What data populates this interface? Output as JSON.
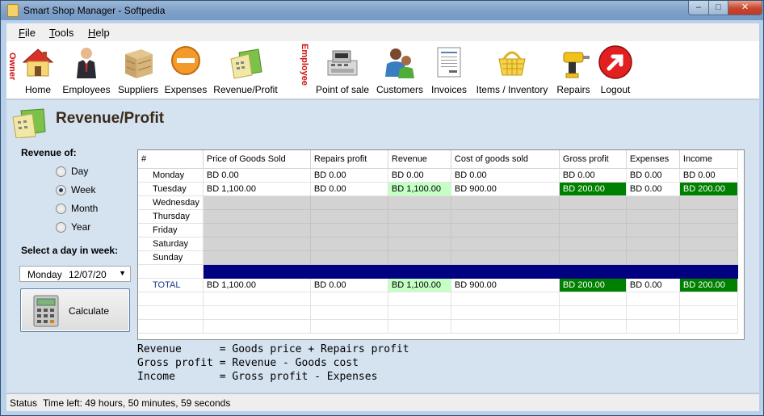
{
  "window": {
    "title": "Smart Shop Manager - Softpedia",
    "controls": {
      "minimize": "–",
      "maximize": "□",
      "close": "✕"
    }
  },
  "menu": {
    "items": [
      {
        "label": "File"
      },
      {
        "label": "Tools"
      },
      {
        "label": "Help"
      }
    ]
  },
  "toolbar": {
    "owner_label": "Owner",
    "employee_label": "Employee",
    "owner_tools": [
      {
        "label": "Home",
        "icon": "home-icon"
      },
      {
        "label": "Employees",
        "icon": "employee-person-icon"
      },
      {
        "label": "Suppliers",
        "icon": "crate-icon"
      },
      {
        "label": "Expenses",
        "icon": "minus-circle-icon"
      },
      {
        "label": "Revenue/Profit",
        "icon": "calculator-folder-icon"
      }
    ],
    "employee_tools": [
      {
        "label": "Point of sale",
        "icon": "cash-register-icon"
      },
      {
        "label": "Customers",
        "icon": "customers-icon"
      },
      {
        "label": "Invoices",
        "icon": "invoice-icon"
      },
      {
        "label": "Items / Inventory",
        "icon": "basket-icon"
      },
      {
        "label": "Repairs",
        "icon": "drill-icon"
      },
      {
        "label": "Logout",
        "icon": "logout-arrow-icon"
      }
    ]
  },
  "page": {
    "title": "Revenue/Profit",
    "revenue_of_label": "Revenue of:",
    "revenue_options": [
      {
        "label": "Day",
        "checked": false
      },
      {
        "label": "Week",
        "checked": true
      },
      {
        "label": "Month",
        "checked": false
      },
      {
        "label": "Year",
        "checked": false
      }
    ],
    "select_day_label": "Select a day in week:",
    "date_picker": {
      "day": "Monday",
      "date": "12/07/20"
    },
    "calculate_label": "Calculate"
  },
  "table": {
    "columns": [
      "#",
      "Price of Goods Sold",
      "Repairs profit",
      "Revenue",
      "Cost of goods sold",
      "Gross profit",
      "Expenses",
      "Income"
    ],
    "rows": [
      {
        "day": "Monday",
        "cells": [
          "BD 0.00",
          "BD 0.00",
          "BD 0.00",
          "BD 0.00",
          "BD 0.00",
          "BD 0.00",
          "BD 0.00"
        ]
      },
      {
        "day": "Tuesday",
        "cells": [
          "BD 1,100.00",
          "BD 0.00",
          "BD 1,100.00",
          "BD 900.00",
          "BD 200.00",
          "BD 0.00",
          "BD 200.00"
        ]
      },
      {
        "day": "Wednesday",
        "cells": [
          "",
          "",
          "",
          "",
          "",
          "",
          ""
        ]
      },
      {
        "day": "Thursday",
        "cells": [
          "",
          "",
          "",
          "",
          "",
          "",
          ""
        ]
      },
      {
        "day": "Friday",
        "cells": [
          "",
          "",
          "",
          "",
          "",
          "",
          ""
        ]
      },
      {
        "day": "Saturday",
        "cells": [
          "",
          "",
          "",
          "",
          "",
          "",
          ""
        ]
      },
      {
        "day": "Sunday",
        "cells": [
          "",
          "",
          "",
          "",
          "",
          "",
          ""
        ]
      }
    ],
    "total": {
      "label": "TOTAL",
      "cells": [
        "BD 1,100.00",
        "BD 0.00",
        "BD 1,100.00",
        "BD 900.00",
        "BD 200.00",
        "BD 0.00",
        "BD 200.00"
      ]
    },
    "highlight_colors": {
      "revenue": "#c4ffc4",
      "gross_profit": "#008000",
      "income": "#008000",
      "separator": "#000080"
    }
  },
  "formulas": {
    "line1": "Revenue      = Goods price + Repairs profit",
    "line2": "Gross profit = Revenue - Goods cost",
    "line3": "Income       = Gross profit - Expenses"
  },
  "status": {
    "label": "Status",
    "text": "Time left: 49 hours, 50 minutes, 59 seconds"
  }
}
